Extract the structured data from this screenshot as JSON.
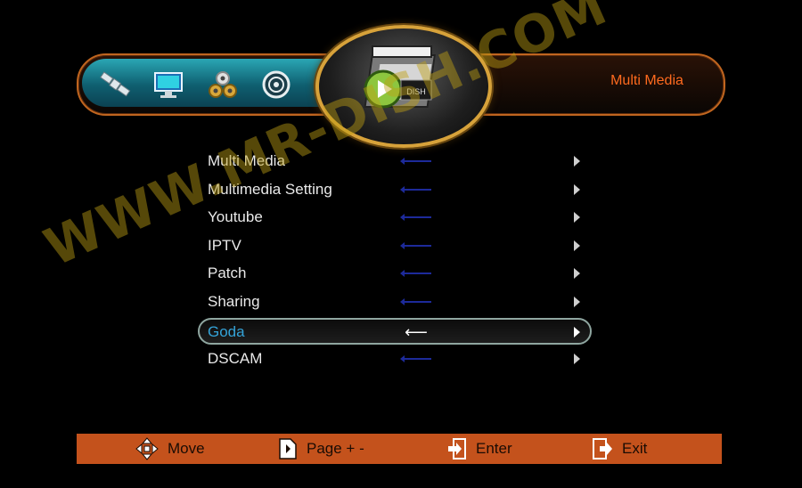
{
  "header": {
    "title": "Multi Media",
    "icons": [
      "satellite-icon",
      "monitor-icon",
      "settings-gears-icon",
      "system-disc-icon"
    ],
    "center_icon": "multimedia-clapboard-icon",
    "center_icon_label": "DISH"
  },
  "menu": {
    "items": [
      {
        "label": "Multi Media",
        "selected": false
      },
      {
        "label": "Multimedia Setting",
        "selected": false
      },
      {
        "label": "Youtube",
        "selected": false
      },
      {
        "label": "IPTV",
        "selected": false
      },
      {
        "label": "Patch",
        "selected": false
      },
      {
        "label": "Sharing",
        "selected": false
      },
      {
        "label": "Goda",
        "selected": true
      },
      {
        "label": "DSCAM",
        "selected": false
      }
    ]
  },
  "footer": {
    "move": "Move",
    "page": "Page + -",
    "enter": "Enter",
    "exit": "Exit"
  },
  "watermark": "WWW.MR-DISH.COM",
  "colors": {
    "accent_orange": "#c4521c",
    "title_orange": "#ff6a1e",
    "selected_text": "#34a3d8",
    "header_teal": "#2aa6b4"
  }
}
